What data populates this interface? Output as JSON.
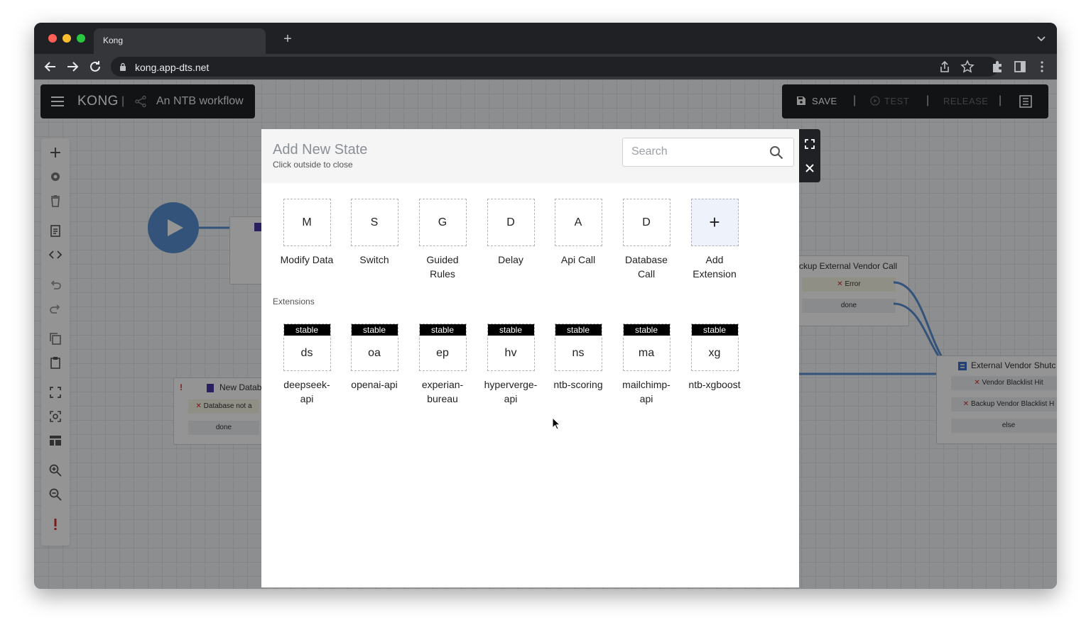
{
  "browser": {
    "tab_title": "Kong",
    "url": "kong.app-dts.net",
    "new_tab": "+"
  },
  "app": {
    "brand": "KONG",
    "separator": "|",
    "workflow_name": "An NTB workflow",
    "actions": {
      "save": "SAVE",
      "test": "TEST",
      "release": "RELEASE",
      "divider": "|"
    }
  },
  "canvas": {
    "nodes": {
      "backup_call": {
        "title": "ckup External Vendor Call",
        "rows": [
          "Error",
          "done"
        ]
      },
      "vendor_shutoff": {
        "title": "External Vendor Shutc",
        "rows": [
          "Vendor Blacklist Hit",
          "Backup Vendor Blacklist H",
          "else"
        ]
      },
      "new_database": {
        "alert": "!",
        "title": "New Databa",
        "rows": [
          "Database not a",
          "done"
        ]
      }
    }
  },
  "modal": {
    "title": "Add New State",
    "subtitle": "Click outside to close",
    "search_placeholder": "Search",
    "states": [
      {
        "abbr": "M",
        "label": "Modify Data"
      },
      {
        "abbr": "S",
        "label": "Switch"
      },
      {
        "abbr": "G",
        "label": "Guided Rules"
      },
      {
        "abbr": "D",
        "label": "Delay"
      },
      {
        "abbr": "A",
        "label": "Api Call"
      },
      {
        "abbr": "D",
        "label": "Database Call"
      },
      {
        "abbr": "+",
        "label": "Add Extension"
      }
    ],
    "extensions_heading": "Extensions",
    "extensions": [
      {
        "badge": "stable",
        "abbr": "ds",
        "label": "deepseek-api"
      },
      {
        "badge": "stable",
        "abbr": "oa",
        "label": "openai-api"
      },
      {
        "badge": "stable",
        "abbr": "ep",
        "label": "experian-bureau"
      },
      {
        "badge": "stable",
        "abbr": "hv",
        "label": "hyperverge-api"
      },
      {
        "badge": "stable",
        "abbr": "ns",
        "label": "ntb-scoring"
      },
      {
        "badge": "stable",
        "abbr": "ma",
        "label": "mailchimp-api"
      },
      {
        "badge": "stable",
        "abbr": "xg",
        "label": "ntb-xgboost"
      }
    ]
  }
}
